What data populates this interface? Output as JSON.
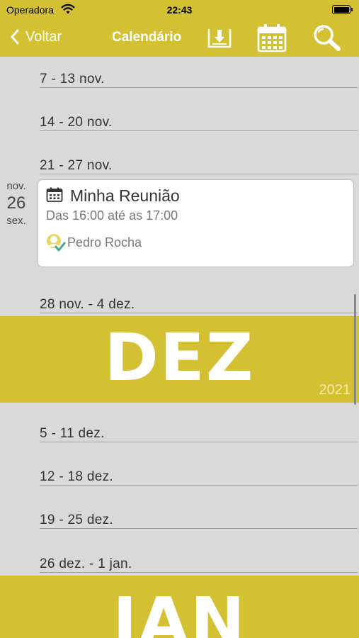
{
  "status": {
    "carrier": "Operadora",
    "time": "22:43"
  },
  "nav": {
    "back_label": "Voltar",
    "title": "Calendário",
    "icons": [
      "chevron-left-icon",
      "download-icon",
      "calendar-icon",
      "search-icon"
    ]
  },
  "weeks_nov": [
    "7 - 13 nov.",
    "14 - 20 nov.",
    "21 - 27 nov.",
    "28 nov. - 4 dez."
  ],
  "day": {
    "month": "nov.",
    "number": "26",
    "weekday": "sex."
  },
  "event": {
    "title": "Minha Reunião",
    "time": "Das 16:00 até as 17:00",
    "person": "Pedro Rocha"
  },
  "banner_dez": {
    "month": "DEZ",
    "year": "2021"
  },
  "weeks_dez": [
    "5 - 11 dez.",
    "12 - 18 dez.",
    "19 - 25 dez.",
    "26 dez. - 1 jan."
  ],
  "banner_jan": {
    "month": "JAN"
  },
  "colors": {
    "accent": "#d4c033",
    "background": "#d9d9d9",
    "card": "#ffffff"
  }
}
